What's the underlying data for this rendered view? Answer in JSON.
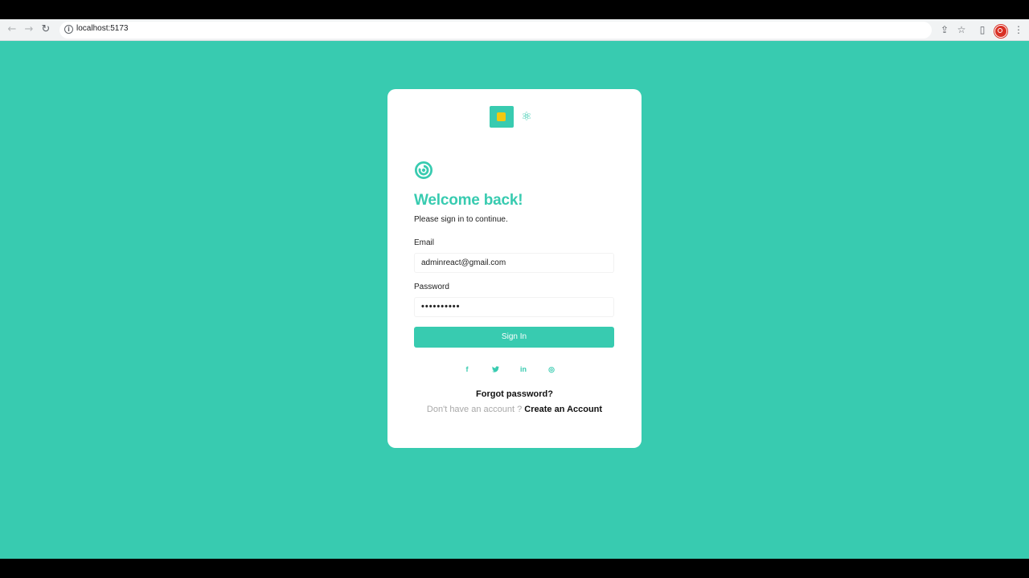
{
  "browser": {
    "url": "localhost:5173",
    "back_icon": "arrow-left-icon",
    "forward_icon": "arrow-right-icon",
    "reload_icon": "reload-icon",
    "info_icon": "info-icon"
  },
  "login": {
    "title": "Welcome back!",
    "subtitle": "Please sign in to continue.",
    "email_label": "Email",
    "email_value": "adminreact@gmail.com",
    "password_label": "Password",
    "password_value": "••••••••••",
    "signin_label": "Sign In",
    "forgot_label": "Forgot password?",
    "no_account_text": "Don't have an account ?",
    "create_label": "Create an Account"
  },
  "socials": [
    {
      "name": "facebook",
      "glyph": "f"
    },
    {
      "name": "twitter",
      "glyph": "🐦"
    },
    {
      "name": "linkedin",
      "glyph": "in"
    },
    {
      "name": "instagram",
      "glyph": "◎"
    }
  ],
  "theme": {
    "accent": "#38cbb0"
  }
}
